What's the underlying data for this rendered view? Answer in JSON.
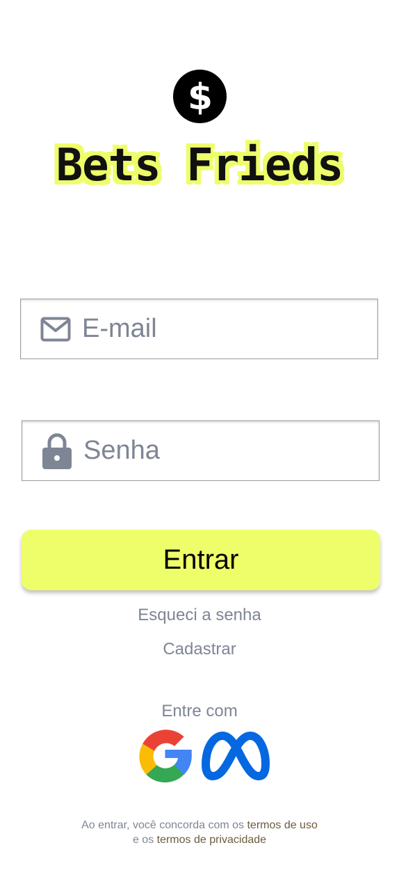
{
  "brand": {
    "logo_icon": "dollar-coin-icon",
    "title": "Bets Frieds",
    "accent_color": "#eefe6a"
  },
  "form": {
    "email": {
      "placeholder": "E-mail",
      "icon": "envelope-icon"
    },
    "password": {
      "placeholder": "Senha",
      "icon": "lock-icon"
    },
    "submit_label": "Entrar"
  },
  "links": {
    "forgot_password": "Esqueci a senha",
    "sign_up": "Cadastrar"
  },
  "social": {
    "label": "Entre com",
    "providers": [
      "google-logo-icon",
      "meta-logo-icon"
    ]
  },
  "terms": {
    "prefix": "Ao entrar, você concorda com os ",
    "terms_of_use": "termos de uso",
    "middle": "e os ",
    "privacy_terms": "termos de privacidade"
  }
}
